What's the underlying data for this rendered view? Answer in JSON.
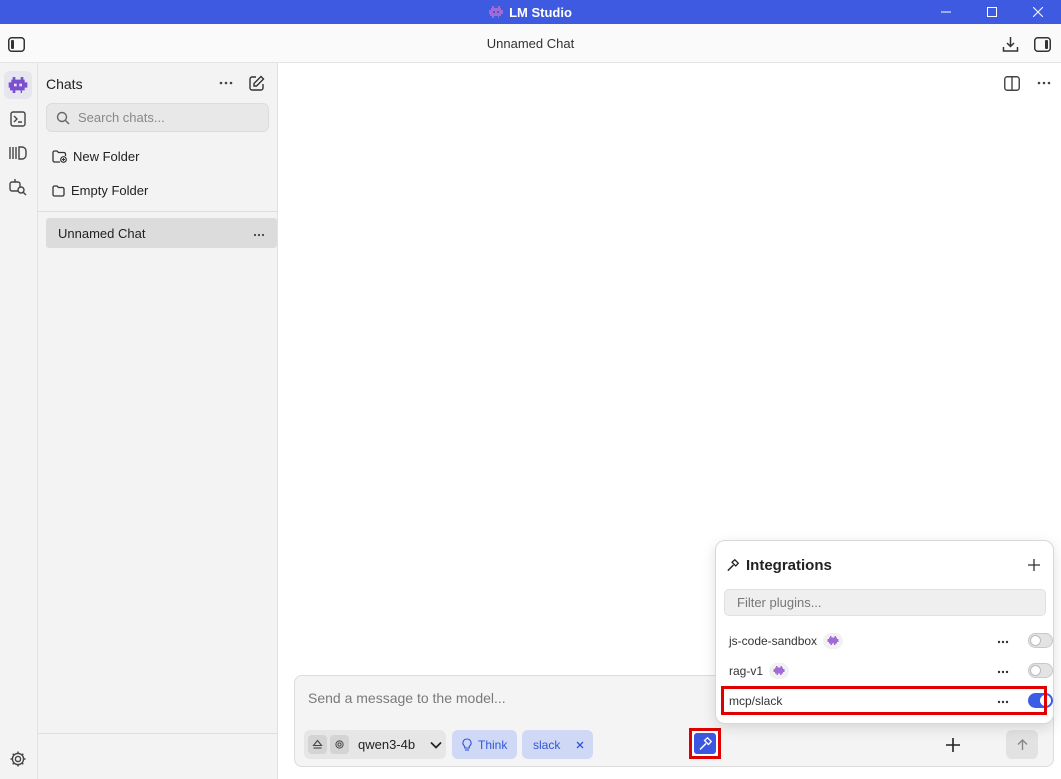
{
  "window": {
    "title": "LM Studio"
  },
  "topbar": {
    "chat_title": "Unnamed Chat"
  },
  "sidebar": {
    "header": "Chats",
    "search_placeholder": "Search chats...",
    "new_folder_label": "New Folder",
    "folders": [
      "Empty Folder"
    ],
    "chats": [
      {
        "label": "Unnamed Chat",
        "selected": true
      }
    ]
  },
  "composer": {
    "placeholder": "Send a message to the model...",
    "model_name": "qwen3-4b",
    "think_label": "Think",
    "tool_tag": "slack"
  },
  "integrations": {
    "title": "Integrations",
    "filter_placeholder": "Filter plugins...",
    "plugins": [
      {
        "name": "js-code-sandbox",
        "enabled": false
      },
      {
        "name": "rag-v1",
        "enabled": false
      },
      {
        "name": "mcp/slack",
        "enabled": true
      }
    ]
  },
  "colors": {
    "accent": "#3d5ae0",
    "highlight": "#e00000",
    "brand_icon": "#a06bd6"
  }
}
